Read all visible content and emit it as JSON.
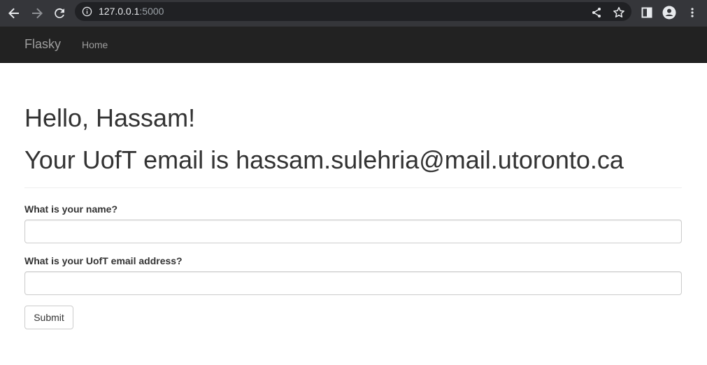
{
  "browser": {
    "url_host": "127.0.0.1",
    "url_port": ":5000",
    "icons": [
      "back-arrow-icon",
      "forward-arrow-icon",
      "reload-icon",
      "site-info-icon",
      "share-icon",
      "bookmark-star-icon",
      "side-panel-icon",
      "profile-icon",
      "more-menu-icon"
    ]
  },
  "navbar": {
    "brand": "Flasky",
    "links": [
      {
        "label": "Home"
      }
    ]
  },
  "main": {
    "greeting": "Hello, Hassam!",
    "email_line": "Your UofT email is hassam.sulehria@mail.utoronto.ca"
  },
  "form": {
    "name_label": "What is your name?",
    "name_value": "",
    "email_label": "What is your UofT email address?",
    "email_value": "",
    "submit_label": "Submit"
  },
  "colors": {
    "chrome_bg": "#35363a",
    "omnibox_bg": "#202124",
    "navbar_bg": "#222222",
    "navbar_text": "#9d9d9d",
    "text": "#333333"
  }
}
